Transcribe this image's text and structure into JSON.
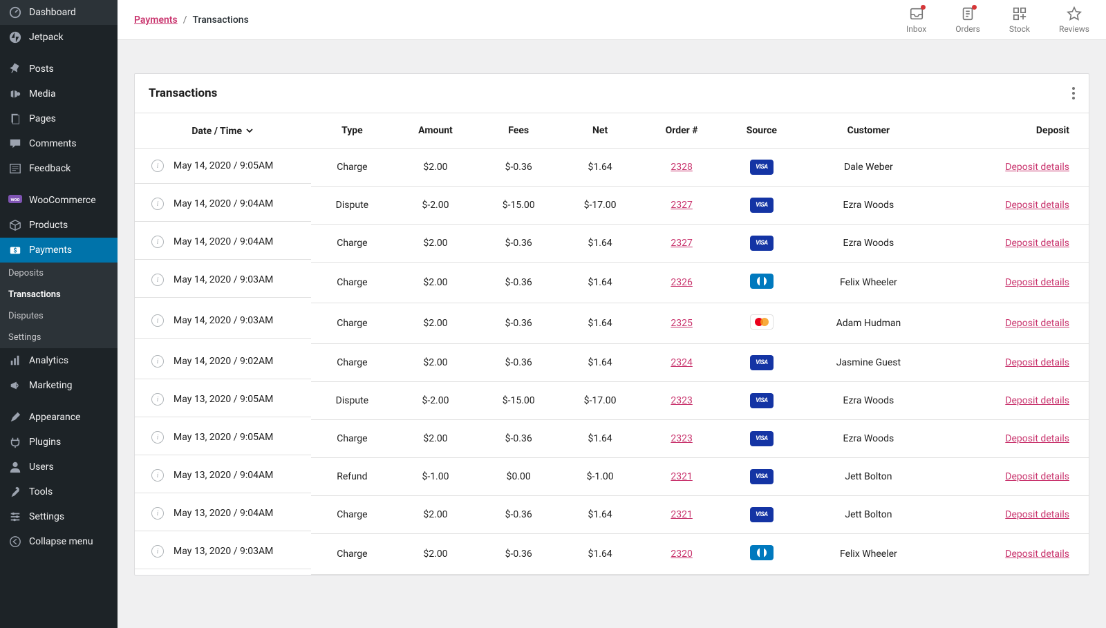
{
  "sidebar": {
    "groups": [
      [
        {
          "icon": "dashboard",
          "label": "Dashboard"
        },
        {
          "icon": "jetpack",
          "label": "Jetpack"
        }
      ],
      [
        {
          "icon": "pin",
          "label": "Posts"
        },
        {
          "icon": "media",
          "label": "Media"
        },
        {
          "icon": "page",
          "label": "Pages"
        },
        {
          "icon": "comment",
          "label": "Comments"
        },
        {
          "icon": "feedback",
          "label": "Feedback"
        }
      ],
      [
        {
          "icon": "woo",
          "label": "WooCommerce"
        },
        {
          "icon": "products",
          "label": "Products"
        },
        {
          "icon": "payments",
          "label": "Payments",
          "active": true,
          "sub": [
            {
              "label": "Deposits"
            },
            {
              "label": "Transactions",
              "active": true
            },
            {
              "label": "Disputes"
            },
            {
              "label": "Settings"
            }
          ]
        },
        {
          "icon": "analytics",
          "label": "Analytics"
        },
        {
          "icon": "marketing",
          "label": "Marketing"
        }
      ],
      [
        {
          "icon": "appearance",
          "label": "Appearance"
        },
        {
          "icon": "plugins",
          "label": "Plugins"
        },
        {
          "icon": "users",
          "label": "Users"
        },
        {
          "icon": "tools",
          "label": "Tools"
        },
        {
          "icon": "settings",
          "label": "Settings"
        },
        {
          "icon": "collapse",
          "label": "Collapse menu"
        }
      ]
    ]
  },
  "breadcrumb": {
    "parent": "Payments",
    "current": "Transactions"
  },
  "topactions": [
    {
      "icon": "inbox",
      "label": "Inbox",
      "dot": true
    },
    {
      "icon": "orders",
      "label": "Orders",
      "dot": true
    },
    {
      "icon": "stock",
      "label": "Stock"
    },
    {
      "icon": "reviews",
      "label": "Reviews"
    }
  ],
  "card": {
    "title": "Transactions",
    "columns": [
      "Date / Time",
      "Type",
      "Amount",
      "Fees",
      "Net",
      "Order #",
      "Source",
      "Customer",
      "Deposit"
    ],
    "deposit_link_label": "Deposit details",
    "rows": [
      {
        "datetime": "May 14, 2020 / 9:05AM",
        "type": "Charge",
        "amount": "$2.00",
        "fees": "$-0.36",
        "net": "$1.64",
        "order": "2328",
        "source": "visa",
        "customer": "Dale Weber"
      },
      {
        "datetime": "May 14, 2020 / 9:04AM",
        "type": "Dispute",
        "amount": "$-2.00",
        "fees": "$-15.00",
        "net": "$-17.00",
        "order": "2327",
        "source": "visa",
        "customer": "Ezra Woods"
      },
      {
        "datetime": "May 14, 2020 / 9:04AM",
        "type": "Charge",
        "amount": "$2.00",
        "fees": "$-0.36",
        "net": "$1.64",
        "order": "2327",
        "source": "visa",
        "customer": "Ezra Woods"
      },
      {
        "datetime": "May 14, 2020 / 9:03AM",
        "type": "Charge",
        "amount": "$2.00",
        "fees": "$-0.36",
        "net": "$1.64",
        "order": "2326",
        "source": "diners",
        "customer": "Felix Wheeler"
      },
      {
        "datetime": "May 14, 2020 / 9:03AM",
        "type": "Charge",
        "amount": "$2.00",
        "fees": "$-0.36",
        "net": "$1.64",
        "order": "2325",
        "source": "mastercard",
        "customer": "Adam Hudman"
      },
      {
        "datetime": "May 14, 2020 / 9:02AM",
        "type": "Charge",
        "amount": "$2.00",
        "fees": "$-0.36",
        "net": "$1.64",
        "order": "2324",
        "source": "visa",
        "customer": "Jasmine Guest"
      },
      {
        "datetime": "May 13, 2020 / 9:05AM",
        "type": "Dispute",
        "amount": "$-2.00",
        "fees": "$-15.00",
        "net": "$-17.00",
        "order": "2323",
        "source": "visa",
        "customer": "Ezra Woods"
      },
      {
        "datetime": "May 13, 2020 / 9:05AM",
        "type": "Charge",
        "amount": "$2.00",
        "fees": "$-0.36",
        "net": "$1.64",
        "order": "2323",
        "source": "visa",
        "customer": "Ezra Woods"
      },
      {
        "datetime": "May 13, 2020 / 9:04AM",
        "type": "Refund",
        "amount": "$-1.00",
        "fees": "$0.00",
        "net": "$-1.00",
        "order": "2321",
        "source": "visa",
        "customer": "Jett Bolton"
      },
      {
        "datetime": "May 13, 2020 / 9:04AM",
        "type": "Charge",
        "amount": "$2.00",
        "fees": "$-0.36",
        "net": "$1.64",
        "order": "2321",
        "source": "visa",
        "customer": "Jett Bolton"
      },
      {
        "datetime": "May 13, 2020 / 9:03AM",
        "type": "Charge",
        "amount": "$2.00",
        "fees": "$-0.36",
        "net": "$1.64",
        "order": "2320",
        "source": "diners",
        "customer": "Felix Wheeler"
      }
    ]
  }
}
